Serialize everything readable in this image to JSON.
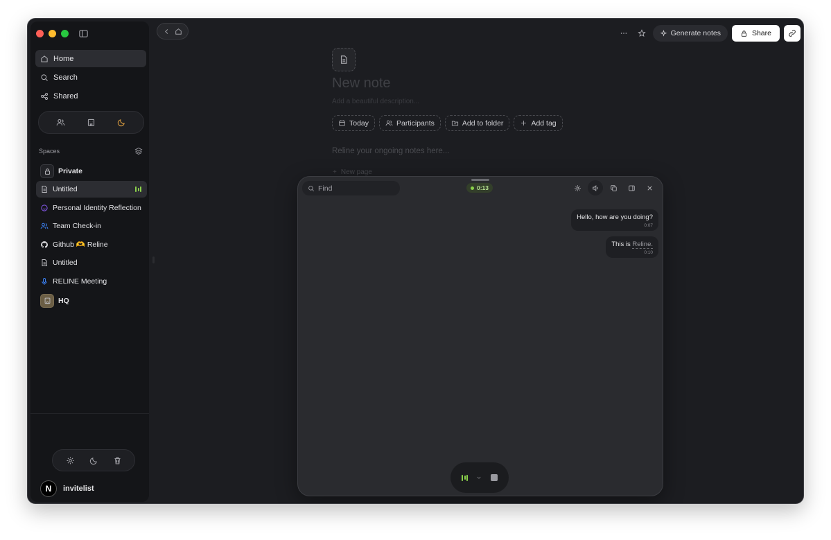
{
  "window": {
    "sidebar_toggle_icon": "sidebar-icon"
  },
  "sidebar": {
    "nav": [
      {
        "label": "Home",
        "icon": "home-icon"
      },
      {
        "label": "Search",
        "icon": "search-icon"
      },
      {
        "label": "Shared",
        "icon": "share-icon"
      }
    ],
    "segment_icons": [
      "people-icon",
      "building-icon",
      "moon-icon"
    ],
    "spaces_label": "Spaces",
    "spaces": [
      {
        "label": "Private",
        "icon": "lock-icon"
      },
      {
        "label": "Untitled",
        "icon": "document-icon",
        "recording": true
      },
      {
        "label": "Personal Identity Reflection",
        "icon": "smiley-icon",
        "color": "#8b5cf6"
      },
      {
        "label": "Team Check-in",
        "icon": "people-icon",
        "color": "#3b82f6"
      },
      {
        "label": "Github 🫶 Reline",
        "icon": "github-icon"
      },
      {
        "label": "Untitled",
        "icon": "document-icon"
      },
      {
        "label": "RELINE Meeting",
        "icon": "microphone-icon",
        "color": "#3b82f6"
      },
      {
        "label": "HQ",
        "icon": "building-icon"
      }
    ],
    "bottom_icons": [
      "gear-icon",
      "moon-icon",
      "trash-icon"
    ],
    "user": {
      "initial": "N",
      "name": "invitelist"
    }
  },
  "toolbar": {
    "generate_label": "Generate notes",
    "share_label": "Share"
  },
  "document": {
    "title": "New note",
    "description": "Add a beautiful description...",
    "chips": [
      {
        "label": "Today",
        "icon": "calendar-icon"
      },
      {
        "label": "Participants",
        "icon": "people-icon"
      },
      {
        "label": "Add to folder",
        "icon": "folder-icon"
      },
      {
        "label": "Add tag",
        "icon": "plus-icon"
      }
    ],
    "body_placeholder": "Reline your ongoing notes here...",
    "new_page": "New page"
  },
  "panel": {
    "find_placeholder": "Find",
    "timer": "0:13",
    "messages": [
      {
        "text": "Hello, how are you doing?",
        "time": "0:07"
      },
      {
        "text_prefix": "This is ",
        "text_highlight": "Reline.",
        "time": "0:10"
      }
    ]
  },
  "colors": {
    "recording_green": "#8bd14b",
    "accent_purple": "#8b5cf6",
    "accent_blue": "#3b82f6"
  }
}
